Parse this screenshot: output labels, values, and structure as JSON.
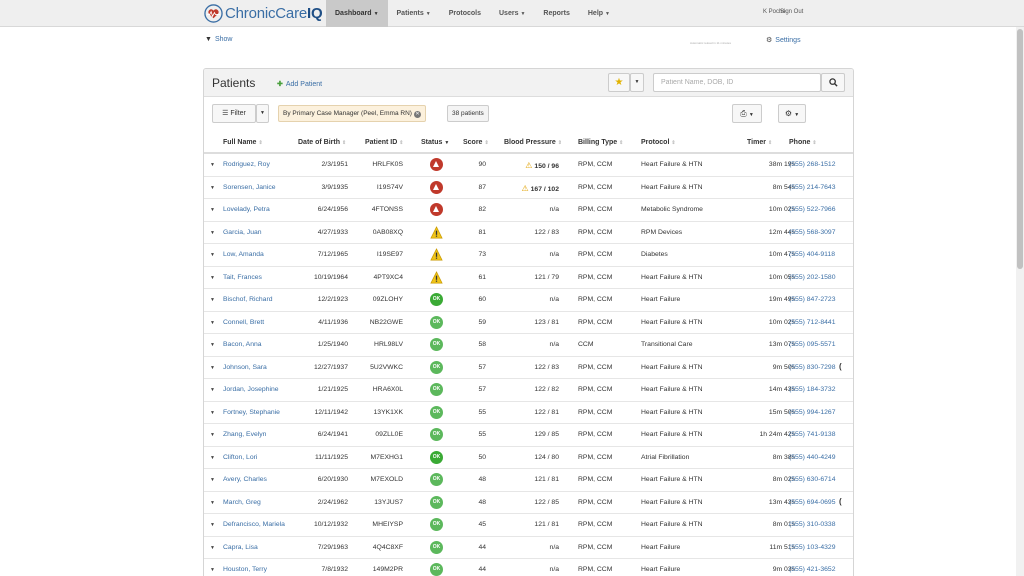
{
  "app": {
    "logo_prefix": "Chronic",
    "logo_mid": "Care",
    "logo_suffix": "IQ"
  },
  "nav": {
    "items": [
      {
        "label": "Dashboard",
        "caret": true,
        "active": true
      },
      {
        "label": "Patients",
        "caret": true
      },
      {
        "label": "Protocols",
        "caret": false
      },
      {
        "label": "Users",
        "caret": true
      },
      {
        "label": "Reports",
        "caret": false
      },
      {
        "label": "Help",
        "caret": true
      }
    ],
    "user": "K Poche",
    "signout": "Sign Out"
  },
  "subbar": {
    "show_label": "Show",
    "auto_refresh": "Automatic reload in 11 minutes",
    "settings_label": "Settings"
  },
  "panel": {
    "title": "Patients",
    "add_label": "Add Patient",
    "search_placeholder": "Patient Name, DOB, ID",
    "filter_label": "Filter",
    "filter_tag": "By Primary Case Manager (Peel, Emma RN)",
    "count_label": "38 patients"
  },
  "table": {
    "headers": [
      "Full Name",
      "Date of Birth",
      "Patient ID",
      "Status",
      "Score",
      "Blood Pressure",
      "Billing Type",
      "Protocol",
      "Timer",
      "Phone"
    ],
    "rows": [
      {
        "name": "Rodriguez, Roy",
        "dob": "2/3/1951",
        "pid": "HRLFK0S",
        "status": "high",
        "score": "90",
        "bp": "150 / 96",
        "bp_alert": true,
        "billing": "RPM, CCM",
        "protocol": "Heart Failure & HTN",
        "timer": "38m 19s",
        "phone": "(555) 268-1512",
        "extra": ""
      },
      {
        "name": "Sorensen, Janice",
        "dob": "3/9/1935",
        "pid": "I19S74V",
        "status": "high",
        "score": "87",
        "bp": "167 / 102",
        "bp_alert": true,
        "billing": "RPM, CCM",
        "protocol": "Heart Failure & HTN",
        "timer": "8m 54s",
        "phone": "(555) 214-7643",
        "extra": ""
      },
      {
        "name": "Lovelady, Petra",
        "dob": "6/24/1956",
        "pid": "4FTONSS",
        "status": "high",
        "score": "82",
        "bp": "n/a",
        "bp_alert": false,
        "billing": "RPM, CCM",
        "protocol": "Metabolic Syndrome",
        "timer": "10m 02s",
        "phone": "(555) 522-7966",
        "extra": ""
      },
      {
        "name": "Garcia, Juan",
        "dob": "4/27/1933",
        "pid": "0AB08XQ",
        "status": "warn",
        "score": "81",
        "bp": "122 / 83",
        "bp_alert": false,
        "billing": "RPM, CCM",
        "protocol": "RPM Devices",
        "timer": "12m 44s",
        "phone": "(555) 568-3097",
        "extra": ""
      },
      {
        "name": "Low, Amanda",
        "dob": "7/12/1965",
        "pid": "I19SE97",
        "status": "warn",
        "score": "73",
        "bp": "n/a",
        "bp_alert": false,
        "billing": "RPM, CCM",
        "protocol": "Diabetes",
        "timer": "10m 47s",
        "phone": "(555) 404-9118",
        "extra": ""
      },
      {
        "name": "Tait, Frances",
        "dob": "10/19/1964",
        "pid": "4PT9XC4",
        "status": "warn",
        "score": "61",
        "bp": "121 / 79",
        "bp_alert": false,
        "billing": "RPM, CCM",
        "protocol": "Heart Failure & HTN",
        "timer": "10m 05s",
        "phone": "(555) 202-1580",
        "extra": ""
      },
      {
        "name": "Bischof, Richard",
        "dob": "12/2/1923",
        "pid": "09ZLOHY",
        "status": "ok",
        "score": "60",
        "bp": "n/a",
        "bp_alert": false,
        "billing": "RPM, CCM",
        "protocol": "Heart Failure",
        "timer": "19m 49s",
        "phone": "(555) 847-2723",
        "extra": ""
      },
      {
        "name": "Connell, Brett",
        "dob": "4/11/1936",
        "pid": "NB22GWE",
        "status": "ok2",
        "score": "59",
        "bp": "123 / 81",
        "bp_alert": false,
        "billing": "RPM, CCM",
        "protocol": "Heart Failure & HTN",
        "timer": "10m 02s",
        "phone": "(555) 712-8441",
        "extra": ""
      },
      {
        "name": "Bacon, Anna",
        "dob": "1/25/1940",
        "pid": "HRL98LV",
        "status": "ok2",
        "score": "58",
        "bp": "n/a",
        "bp_alert": false,
        "billing": "CCM",
        "protocol": "Transitional Care",
        "timer": "13m 07s",
        "phone": "(555) 095-5571",
        "extra": ""
      },
      {
        "name": "Johnson, Sara",
        "dob": "12/27/1937",
        "pid": "5U2VWKC",
        "status": "ok2",
        "score": "57",
        "bp": "122 / 83",
        "bp_alert": false,
        "billing": "RPM, CCM",
        "protocol": "Heart Failure & HTN",
        "timer": "9m 50s",
        "phone": "(555) 830-7298",
        "extra": "("
      },
      {
        "name": "Jordan, Josephine",
        "dob": "1/21/1925",
        "pid": "HRA6X0L",
        "status": "ok2",
        "score": "57",
        "bp": "122 / 82",
        "bp_alert": false,
        "billing": "RPM, CCM",
        "protocol": "Heart Failure & HTN",
        "timer": "14m 43s",
        "phone": "(555) 184-3732",
        "extra": ""
      },
      {
        "name": "Fortney, Stephanie",
        "dob": "12/11/1942",
        "pid": "13YK1XK",
        "status": "ok2",
        "score": "55",
        "bp": "122 / 81",
        "bp_alert": false,
        "billing": "RPM, CCM",
        "protocol": "Heart Failure & HTN",
        "timer": "15m 50s",
        "phone": "(555) 994-1267",
        "extra": ""
      },
      {
        "name": "Zhang, Evelyn",
        "dob": "6/24/1941",
        "pid": "09ZLL0E",
        "status": "ok2",
        "score": "55",
        "bp": "129 / 85",
        "bp_alert": false,
        "billing": "RPM, CCM",
        "protocol": "Heart Failure & HTN",
        "timer": "1h 24m 42s",
        "phone": "(555) 741-9138",
        "extra": ""
      },
      {
        "name": "Clifton, Lori",
        "dob": "11/11/1925",
        "pid": "M7EXHG1",
        "status": "ok",
        "score": "50",
        "bp": "124 / 80",
        "bp_alert": false,
        "billing": "RPM, CCM",
        "protocol": "Atrial Fibrillation",
        "timer": "8m 38s",
        "phone": "(555) 440-4249",
        "extra": ""
      },
      {
        "name": "Avery, Charles",
        "dob": "6/20/1930",
        "pid": "M7EXOLD",
        "status": "ok2",
        "score": "48",
        "bp": "121 / 81",
        "bp_alert": false,
        "billing": "RPM, CCM",
        "protocol": "Heart Failure & HTN",
        "timer": "8m 02s",
        "phone": "(555) 630-6714",
        "extra": ""
      },
      {
        "name": "March, Greg",
        "dob": "2/24/1962",
        "pid": "13YJUS7",
        "status": "ok2",
        "score": "48",
        "bp": "122 / 85",
        "bp_alert": false,
        "billing": "RPM, CCM",
        "protocol": "Heart Failure & HTN",
        "timer": "13m 43s",
        "phone": "(555) 694-0695",
        "extra": "("
      },
      {
        "name": "Defrancisco, Mariela",
        "dob": "10/12/1932",
        "pid": "MHEIYSP",
        "status": "ok2",
        "score": "45",
        "bp": "121 / 81",
        "bp_alert": false,
        "billing": "RPM, CCM",
        "protocol": "Heart Failure & HTN",
        "timer": "8m 01s",
        "phone": "(555) 310-0338",
        "extra": ""
      },
      {
        "name": "Capra, Lisa",
        "dob": "7/29/1963",
        "pid": "4Q4C8XF",
        "status": "ok2",
        "score": "44",
        "bp": "n/a",
        "bp_alert": false,
        "billing": "RPM, CCM",
        "protocol": "Heart Failure",
        "timer": "11m 51s",
        "phone": "(555) 103-4329",
        "extra": ""
      },
      {
        "name": "Houston, Terry",
        "dob": "7/8/1932",
        "pid": "149M2PR",
        "status": "ok2",
        "score": "44",
        "bp": "n/a",
        "bp_alert": false,
        "billing": "RPM, CCM",
        "protocol": "Heart Failure",
        "timer": "9m 03s",
        "phone": "(555) 421-3652",
        "extra": ""
      }
    ],
    "status_text_ok": "OK",
    "status_text_ok2": "OK"
  }
}
